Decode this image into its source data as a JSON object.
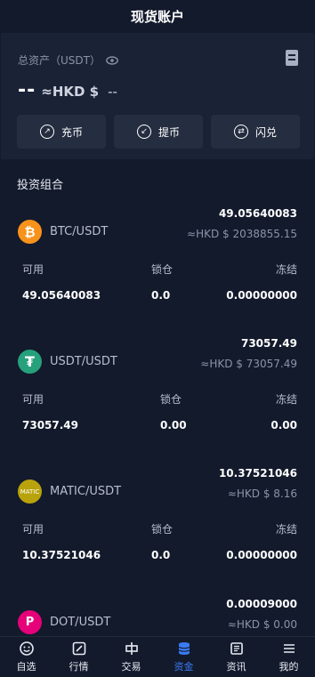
{
  "header": {
    "title": "现货账户"
  },
  "summary": {
    "total_label": "总资产（USDT）",
    "total_value": "--",
    "hkd_label": "≈HKD $",
    "hkd_value": "--",
    "actions": [
      {
        "label": "充币",
        "icon": "deposit-icon"
      },
      {
        "label": "提币",
        "icon": "withdraw-icon"
      },
      {
        "label": "闪兑",
        "icon": "swap-icon"
      }
    ]
  },
  "portfolio": {
    "title": "投资组合",
    "columns": [
      "可用",
      "锁仓",
      "冻结"
    ],
    "assets": [
      {
        "pair": "BTC/USDT",
        "amount": "49.05640083",
        "fiat": "≈HKD $  2038855.15",
        "available": "49.05640083",
        "locked": "0.0",
        "frozen": "0.00000000",
        "icon_text": "₿",
        "color": "#f7931a"
      },
      {
        "pair": "USDT/USDT",
        "amount": "73057.49",
        "fiat": "≈HKD $  73057.49",
        "available": "73057.49",
        "locked": "0.00",
        "frozen": "0.00",
        "icon_text": "₮",
        "color": "#26a17b"
      },
      {
        "pair": "MATIC/USDT",
        "amount": "10.37521046",
        "fiat": "≈HKD $  8.16",
        "available": "10.37521046",
        "locked": "0.0",
        "frozen": "0.00000000",
        "icon_text": "MATIC",
        "color": "#b8a30c"
      },
      {
        "pair": "DOT/USDT",
        "amount": "0.00009000",
        "fiat": "≈HKD $  0.00",
        "icon_text": "P",
        "color": "#e6007a"
      }
    ]
  },
  "nav": {
    "items": [
      {
        "label": "自选",
        "icon": "smile-icon"
      },
      {
        "label": "行情",
        "icon": "chart-icon"
      },
      {
        "label": "交易",
        "icon": "trade-icon"
      },
      {
        "label": "资金",
        "icon": "coins-icon",
        "active": true
      },
      {
        "label": "资讯",
        "icon": "news-icon"
      },
      {
        "label": "我的",
        "icon": "menu-icon"
      }
    ]
  },
  "colors": {
    "background": "#131a2c",
    "card": "#1a2236",
    "button": "#252d40",
    "accent": "#3b7bf2"
  }
}
